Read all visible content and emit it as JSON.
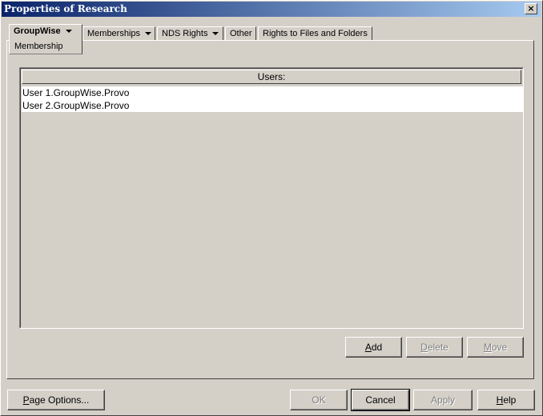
{
  "window": {
    "title": "Properties of Research",
    "close_label": "×"
  },
  "tabs": [
    {
      "label": "GroupWise",
      "sub_label": "Membership",
      "has_dropdown": true,
      "active": true
    },
    {
      "label": "Memberships",
      "has_dropdown": true
    },
    {
      "label": "NDS Rights",
      "has_dropdown": true
    },
    {
      "label": "Other",
      "has_dropdown": false
    },
    {
      "label": "Rights to Files and Folders",
      "has_dropdown": false
    }
  ],
  "users_list": {
    "header": "Users:",
    "items": [
      "User 1.GroupWise.Provo",
      "User 2.GroupWise.Provo"
    ]
  },
  "list_buttons": {
    "add": {
      "accel": "A",
      "rest": "dd",
      "enabled": true
    },
    "delete": {
      "accel": "D",
      "rest": "elete",
      "enabled": false
    },
    "move": {
      "accel": "M",
      "rest": "ove",
      "enabled": false
    }
  },
  "footer": {
    "page_options": {
      "accel": "P",
      "rest": "age Options...",
      "enabled": true
    },
    "ok": {
      "label": "OK",
      "enabled": false
    },
    "cancel": {
      "label": "Cancel",
      "enabled": true
    },
    "apply": {
      "label": "Apply",
      "enabled": false
    },
    "help": {
      "accel": "H",
      "rest": "elp",
      "enabled": true
    }
  }
}
